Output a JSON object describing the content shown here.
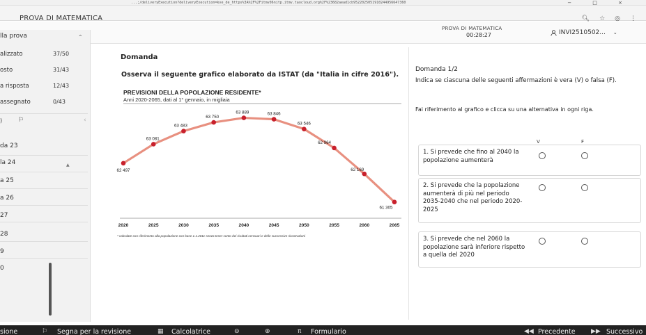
{
  "browser": {
    "url": "...;/deliveryExecution?deliveryExecution=kve_de_https%3A%2F%2Fitmv06nitp.itmv.taocloud.org%2F%23682aead1cb9522025051910244956647360",
    "controls": "− □ ×"
  },
  "tab": {
    "title": "PROVA DI MATEMATICA"
  },
  "header": {
    "exam_name": "PROVA DI MATEMATICA",
    "timer": "00:28:27",
    "user": "INVI2510502...",
    "user_icon": "user-icon"
  },
  "sidebar": {
    "section_title": "lla prova",
    "stats": [
      {
        "label": "alizzato",
        "value": "37/50"
      },
      {
        "label": "osto",
        "value": "31/43"
      },
      {
        "label": "a risposta",
        "value": "12/43"
      },
      {
        "label": "assegnato",
        "value": "0/43"
      }
    ],
    "flag_label": ")",
    "items": [
      {
        "label": "da 23"
      },
      {
        "label": "la 24"
      },
      {
        "label": "a 25"
      },
      {
        "label": "a 26"
      },
      {
        "label": "27"
      },
      {
        "label": "28"
      },
      {
        "label": "9"
      },
      {
        "label": "0"
      }
    ]
  },
  "main": {
    "domanda_label": "Domanda",
    "question": "Osserva il seguente grafico elaborato da ISTAT (da \"Italia in cifre 2016\")."
  },
  "chart_data": {
    "type": "line",
    "title": "PREVISIONI DELLA POPOLAZIONE RESIDENTE*",
    "subtitle": "Anni 2020-2065, dati al 1° gennaio, in migliaia",
    "x": [
      2020,
      2025,
      2030,
      2035,
      2040,
      2045,
      2050,
      2055,
      2060,
      2065
    ],
    "points": [
      {
        "x": 2020,
        "y": 62497,
        "label": "62 497"
      },
      {
        "x": 2025,
        "y": 63081,
        "label": "63 081"
      },
      {
        "x": 2030,
        "y": 63483,
        "label": "63 483"
      },
      {
        "x": 2035,
        "y": 63750,
        "label": "63 750"
      },
      {
        "x": 2040,
        "y": 63889,
        "label": "63 889"
      },
      {
        "x": 2045,
        "y": 63846,
        "label": "63 846"
      },
      {
        "x": 2050,
        "y": 63546,
        "label": "63 546"
      },
      {
        "x": 2055,
        "y": 62964,
        "label": "62 964"
      },
      {
        "x": 2060,
        "y": 62169,
        "label": "62 169"
      },
      {
        "x": 2065,
        "y": 61305,
        "label": "61 305"
      }
    ],
    "ylim": [
      61000,
      64200
    ],
    "note": "* calcolate con riferimento alla popolazione con base 1.1.2011 senza tener conto dei risultati censuari e delle successive ricostruzioni",
    "line_color": "#e89080",
    "marker_color": "#c8202c"
  },
  "right": {
    "counter": "Domanda 1/2",
    "instruction1": "Indica se ciascuna delle seguenti affermazioni è vera (V) o falsa (F).",
    "instruction2": "Fai riferimento al grafico e clicca su una alternativa in ogni riga.",
    "col_v": "V",
    "col_f": "F",
    "statements": [
      {
        "text": "1. Si prevede che fino al 2040 la popolazione aumenterà"
      },
      {
        "text": "2. Si prevede che la popolazione aumenterà di più nel periodo 2035-2040 che nel periodo 2020-2025"
      },
      {
        "text": "3. Si prevede che nel 2060 la popolazione sarà inferiore rispetto a quella del 2020"
      }
    ]
  },
  "footer": {
    "left": "sione",
    "review": "Segna per la revisione",
    "calculator": "Calcolatrice",
    "formulario": "Formulario",
    "prev": "Precedente",
    "next": "Successivo"
  }
}
